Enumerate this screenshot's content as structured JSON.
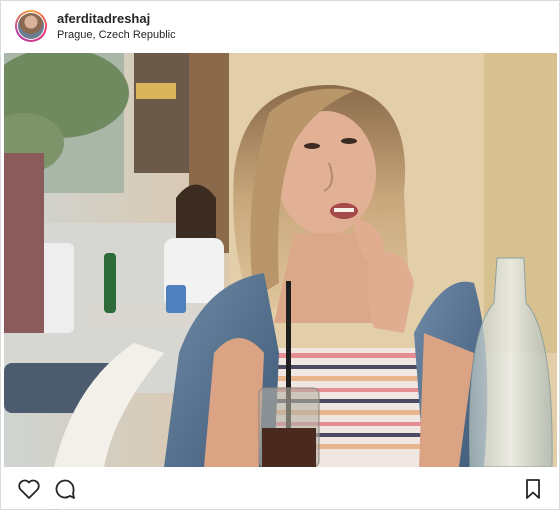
{
  "post": {
    "username": "aferditadreshaj",
    "location": "Prague, Czech Republic"
  },
  "icons": {
    "like": "heart-icon",
    "comment": "comment-icon",
    "save": "bookmark-icon"
  },
  "colors": {
    "text": "#262626",
    "border": "#dbdbdb",
    "story_ring_start": "#f9a43b",
    "story_ring_end": "#b23aa7"
  }
}
